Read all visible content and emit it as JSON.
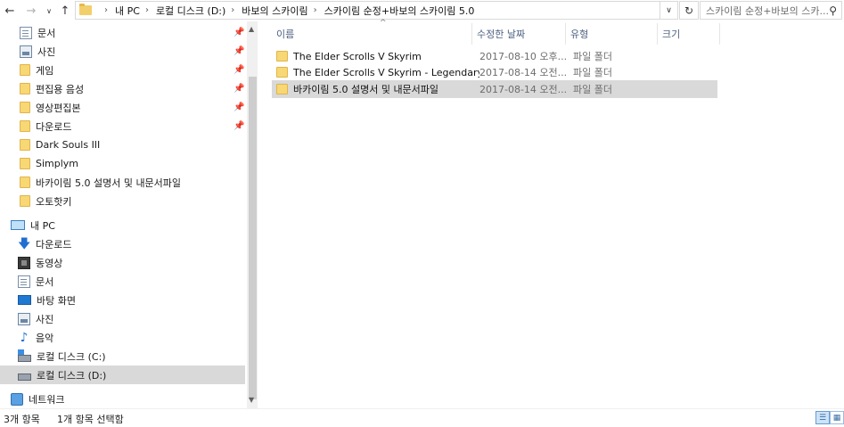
{
  "address": {
    "crumbs": [
      "내 PC",
      "로컬 디스크 (D:)",
      "바보의 스카이림",
      "스카이림 순정+바보의 스카이림 5.0"
    ],
    "search_placeholder": "스카이림 순정+바보의 스카..."
  },
  "nav": {
    "quick_access": [
      {
        "label": "문서",
        "icon": "document-icon"
      },
      {
        "label": "사진",
        "icon": "pictures-icon"
      },
      {
        "label": "게임",
        "icon": "folder-icon"
      },
      {
        "label": "편집용 음성",
        "icon": "folder-icon"
      },
      {
        "label": "영상편집본",
        "icon": "folder-icon"
      },
      {
        "label": "다운로드",
        "icon": "folder-icon"
      },
      {
        "label": "Dark Souls III",
        "icon": "folder-icon"
      },
      {
        "label": "Simplym",
        "icon": "folder-icon"
      },
      {
        "label": "바카이림 5.0 설명서 및 내문서파일",
        "icon": "folder-icon"
      },
      {
        "label": "오토핫키",
        "icon": "folder-icon"
      }
    ],
    "this_pc": {
      "label": "내 PC"
    },
    "pc_items": [
      {
        "label": "다운로드",
        "icon": "downloads-icon"
      },
      {
        "label": "동영상",
        "icon": "videos-icon"
      },
      {
        "label": "문서",
        "icon": "document-icon"
      },
      {
        "label": "바탕 화면",
        "icon": "desktop-icon"
      },
      {
        "label": "사진",
        "icon": "pictures-icon"
      },
      {
        "label": "음악",
        "icon": "music-icon"
      },
      {
        "label": "로컬 디스크 (C:)",
        "icon": "drive-c-icon"
      },
      {
        "label": "로컬 디스크 (D:)",
        "icon": "drive-d-icon"
      }
    ],
    "network": {
      "label": "네트워크"
    }
  },
  "columns": {
    "name": "이름",
    "date": "수정한 날짜",
    "type": "유형",
    "size": "크기"
  },
  "files": [
    {
      "name": "The Elder Scrolls V Skyrim",
      "date": "2017-08-10 오후...",
      "type": "파일 폴더"
    },
    {
      "name": "The Elder Scrolls V Skyrim - Legendary ...",
      "date": "2017-08-14 오전...",
      "type": "파일 폴더"
    },
    {
      "name": "바카이림 5.0 설명서 및 내문서파일",
      "date": "2017-08-14 오전...",
      "type": "파일 폴더"
    }
  ],
  "status": {
    "count": "3개 항목",
    "selected": "1개 항목 선택함"
  },
  "colors": {
    "selection": "#d9d9d9",
    "folder": "#f8d775",
    "header_text": "#4d6082"
  }
}
